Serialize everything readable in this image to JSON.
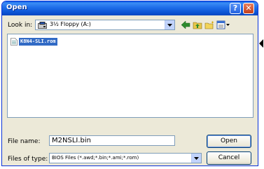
{
  "window": {
    "title": "Open"
  },
  "lookin": {
    "label": "Look in:",
    "value": "3½ Floppy (A:)"
  },
  "files": [
    {
      "name": "K8N4-SLI.rom",
      "selected": true
    }
  ],
  "filename": {
    "label": "File name:",
    "value": "M2NSLI.bin"
  },
  "filetype": {
    "label": "Files of type:",
    "value": "BIOS Files (*.awd;*.bin;*.ami;*.rom)"
  },
  "buttons": {
    "open": "Open",
    "cancel": "Cancel"
  },
  "colors": {
    "selection": "#316ac5",
    "titlebar": "#0b53d3",
    "dialog_bg": "#ece9d8"
  }
}
